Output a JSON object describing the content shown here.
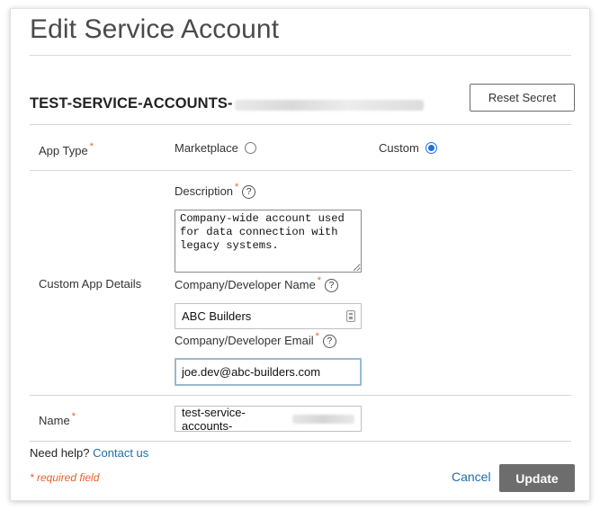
{
  "dialog": {
    "title": "Edit Service Account",
    "account_prefix": "TEST-SERVICE-ACCOUNTS-",
    "reset_label": "Reset Secret"
  },
  "app_type": {
    "label": "App Type",
    "required_mark": "*",
    "options": [
      {
        "label": "Marketplace",
        "checked": false
      },
      {
        "label": "Custom",
        "checked": true
      }
    ]
  },
  "custom_app": {
    "label": "Custom App Details",
    "description": {
      "label": "Description",
      "required_mark": "*",
      "help": "?",
      "value": "Company-wide account used for data connection with legacy systems."
    },
    "developer_name": {
      "label": "Company/Developer Name",
      "required_mark": "*",
      "help": "?",
      "value": "ABC Builders"
    },
    "developer_email": {
      "label": "Company/Developer Email",
      "required_mark": "*",
      "help": "?",
      "value": "joe.dev@abc-builders.com"
    }
  },
  "name_field": {
    "label": "Name",
    "required_mark": "*",
    "value_prefix": "test-service-accounts-"
  },
  "footer": {
    "need_help": "Need help?",
    "contact_link": "Contact us",
    "required_note": "* required field",
    "cancel_label": "Cancel",
    "update_label": "Update"
  },
  "colors": {
    "required": "#e8612c",
    "link": "#1d6fa8",
    "radio_selected": "#1d6fe0",
    "update_button": "#6d6d6d"
  }
}
